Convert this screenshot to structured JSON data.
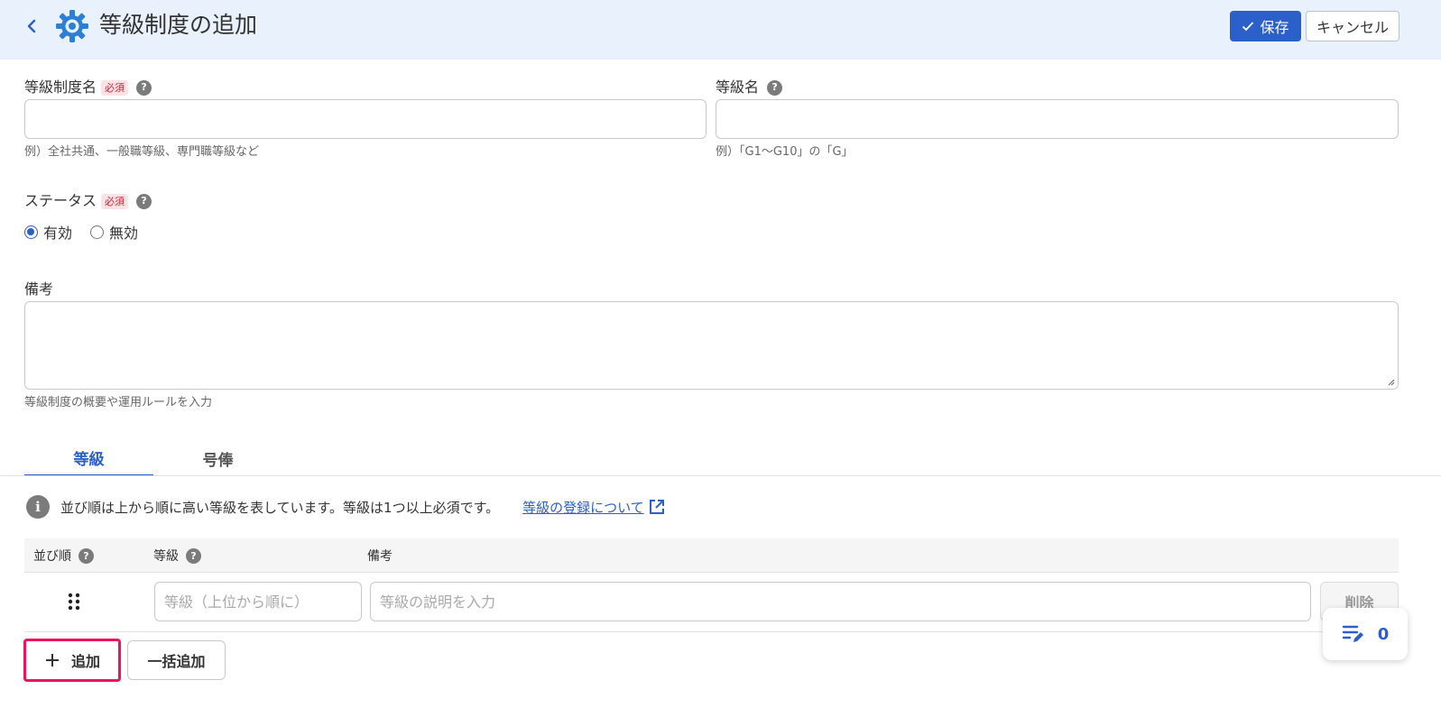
{
  "header": {
    "title": "等級制度の追加",
    "save_label": "保存",
    "cancel_label": "キャンセル"
  },
  "form": {
    "system_name": {
      "label": "等級制度名",
      "required_badge": "必須",
      "value": "",
      "hint": "例）全社共通、一般職等級、専門職等級など"
    },
    "grade_name": {
      "label": "等級名",
      "value": "",
      "hint": "例）「G1～G10」の「G」"
    },
    "status": {
      "label": "ステータス",
      "required_badge": "必須",
      "options": [
        "有効",
        "無効"
      ],
      "selected": "有効"
    },
    "remarks": {
      "label": "備考",
      "value": "",
      "hint": "等級制度の概要や運用ルールを入力"
    }
  },
  "tabs": [
    {
      "label": "等級",
      "active": true
    },
    {
      "label": "号俸",
      "active": false
    }
  ],
  "info": {
    "text": "並び順は上から順に高い等級を表しています。等級は1つ以上必須です。",
    "link_text": "等級の登録について"
  },
  "table": {
    "headers": {
      "order": "並び順",
      "grade": "等級",
      "remarks": "備考"
    },
    "row": {
      "grade_placeholder": "等級（上位から順に）",
      "remarks_placeholder": "等級の説明を入力",
      "delete_label": "削除"
    }
  },
  "actions": {
    "add_label": "追加",
    "bulk_add_label": "一括追加"
  },
  "floating": {
    "edit_count": "0"
  },
  "colors": {
    "accent": "#2b5fc9",
    "header_bg": "#e8f1fc",
    "highlight": "#f0125f",
    "required_bg": "#fde3e6",
    "required_text": "#c9213b"
  }
}
